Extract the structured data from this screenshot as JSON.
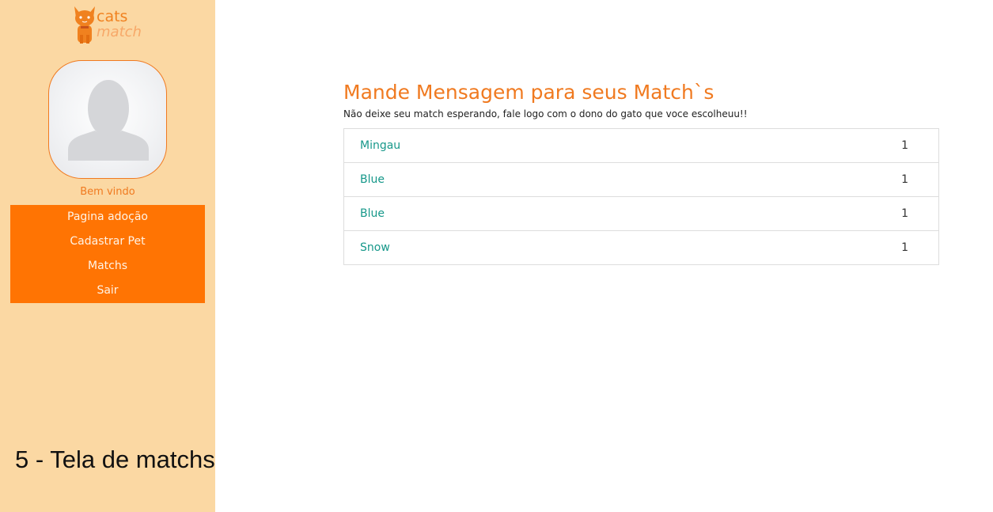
{
  "logo": {
    "line1": "cats",
    "line2": "match"
  },
  "sidebar": {
    "welcome": "Bem vindo",
    "nav": [
      {
        "label": "Pagina adoção"
      },
      {
        "label": "Cadastrar Pet"
      },
      {
        "label": "Matchs"
      },
      {
        "label": "Sair"
      }
    ]
  },
  "caption": "5 - Tela de matchs",
  "main": {
    "title": "Mande Mensagem para seus Match`s",
    "subtitle": "Não deixe seu match esperando, fale logo com o dono do gato que voce escolheuu!!",
    "matches": [
      {
        "name": "Mingau",
        "count": "1"
      },
      {
        "name": "Blue",
        "count": "1"
      },
      {
        "name": "Blue",
        "count": "1"
      },
      {
        "name": "Snow",
        "count": "1"
      }
    ]
  },
  "colors": {
    "sidebar_bg": "#fbd8a3",
    "accent": "#ff7403",
    "title": "#f07a20",
    "link": "#17988a"
  },
  "icons": [
    "cat-logo-icon",
    "avatar-placeholder-icon"
  ]
}
